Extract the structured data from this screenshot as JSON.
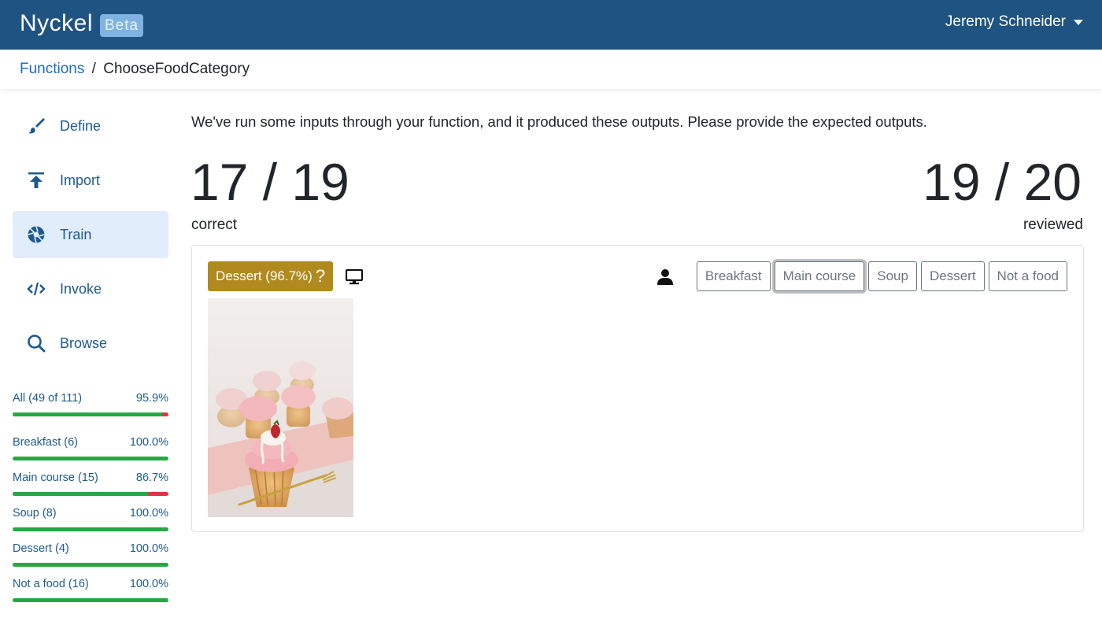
{
  "header": {
    "brand": "Nyckel",
    "badge": "Beta",
    "user_name": "Jeremy Schneider",
    "bg_color": "#1f5381"
  },
  "breadcrumb": {
    "link": "Functions",
    "separator": "/",
    "current": "ChooseFoodCategory"
  },
  "sidebar": {
    "items": [
      {
        "label": "Define",
        "icon": "brush-icon",
        "active": false
      },
      {
        "label": "Import",
        "icon": "upload-icon",
        "active": false
      },
      {
        "label": "Train",
        "icon": "aperture-icon",
        "active": true
      },
      {
        "label": "Invoke",
        "icon": "code-icon",
        "active": false
      },
      {
        "label": "Browse",
        "icon": "search-icon",
        "active": false
      }
    ]
  },
  "stats": [
    {
      "label": "All (49 of 111)",
      "pct": "95.9%",
      "value": 0.959
    },
    {
      "label": "Breakfast (6)",
      "pct": "100.0%",
      "value": 1.0
    },
    {
      "label": "Main course (15)",
      "pct": "86.7%",
      "value": 0.867
    },
    {
      "label": "Soup (8)",
      "pct": "100.0%",
      "value": 1.0
    },
    {
      "label": "Dessert (4)",
      "pct": "100.0%",
      "value": 1.0
    },
    {
      "label": "Not a food (16)",
      "pct": "100.0%",
      "value": 1.0
    }
  ],
  "main": {
    "instructions": "We've run some inputs through your function, and it produced these outputs. Please provide the expected outputs.",
    "correct_value": "17 / 19",
    "correct_label": "correct",
    "reviewed_value": "19 / 20",
    "reviewed_label": "reviewed"
  },
  "card": {
    "prediction": "Dessert (96.7%)",
    "prediction_q": "?",
    "prediction_color": "#b08a1e",
    "label_buttons": [
      "Breakfast",
      "Main course",
      "Soup",
      "Dessert",
      "Not a food"
    ],
    "focused_button": "Main course"
  }
}
